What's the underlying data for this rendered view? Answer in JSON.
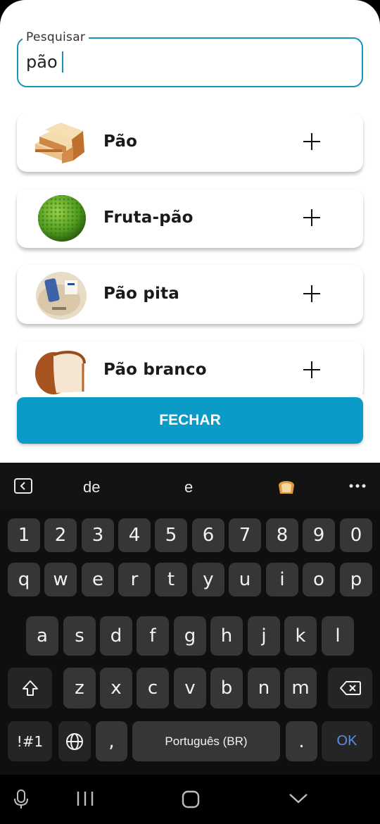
{
  "search": {
    "label": "Pesquisar",
    "value": "pão"
  },
  "results": [
    {
      "name": "Pão",
      "icon": "bread-slices-image"
    },
    {
      "name": "Fruta-pão",
      "icon": "breadfruit-image"
    },
    {
      "name": "Pão pita",
      "icon": "pita-bread-package-image"
    },
    {
      "name": "Pão branco",
      "icon": "white-bread-loaf-image"
    }
  ],
  "close_label": "FECHAR",
  "keyboard": {
    "suggestions": [
      "de",
      "e"
    ],
    "emoji_suggestion": "bread-emoji",
    "numbers": [
      "1",
      "2",
      "3",
      "4",
      "5",
      "6",
      "7",
      "8",
      "9",
      "0"
    ],
    "row1": [
      "q",
      "w",
      "e",
      "r",
      "t",
      "y",
      "u",
      "i",
      "o",
      "p"
    ],
    "row2": [
      "a",
      "s",
      "d",
      "f",
      "g",
      "h",
      "j",
      "k",
      "l"
    ],
    "row3": [
      "z",
      "x",
      "c",
      "v",
      "b",
      "n",
      "m"
    ],
    "symbols": "!#1",
    "comma": ",",
    "space": "Português (BR)",
    "period": ".",
    "ok": "OK"
  },
  "colors": {
    "accent": "#0a9cc7",
    "border": "#1a93b8",
    "key": "#363636",
    "ok": "#5a8fe8"
  }
}
